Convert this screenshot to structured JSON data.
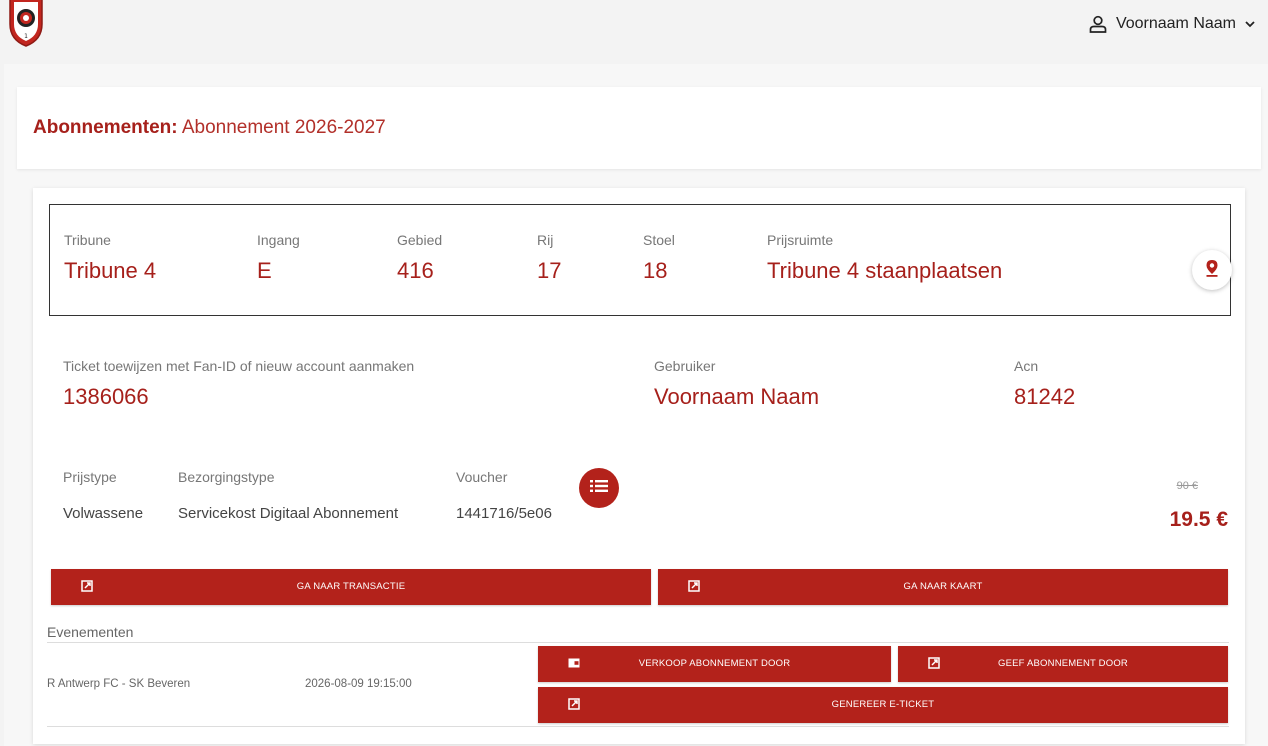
{
  "header": {
    "logo_icon": "club-crest-icon",
    "user_name": "Voornaam Naam",
    "user_icon": "user-icon",
    "chevron_icon": "chevron-down-icon"
  },
  "page": {
    "title_bold": "Abonnementen:",
    "title_rest": "Abonnement 2026-2027"
  },
  "seat": {
    "tribune_label": "Tribune",
    "tribune": "Tribune 4",
    "ingang_label": "Ingang",
    "ingang": "E",
    "gebied_label": "Gebied",
    "gebied": "416",
    "rij_label": "Rij",
    "rij": "17",
    "stoel_label": "Stoel",
    "stoel": "18",
    "prijsruimte_label": "Prijsruimte",
    "prijsruimte": "Tribune 4 staanplaatsen",
    "map_icon": "map-pin-icon"
  },
  "owner": {
    "fanid_label": "Ticket toewijzen met Fan-ID of nieuw account aanmaken",
    "fanid": "1386066",
    "gebruiker_label": "Gebruiker",
    "gebruiker": "Voornaam Naam",
    "acn_label": "Acn",
    "acn": "81242"
  },
  "pricing": {
    "prijstype_label": "Prijstype",
    "prijstype": "Volwassene",
    "bezorgingstype_label": "Bezorgingstype",
    "bezorgingstype": "Servicekost Digitaal Abonnement",
    "voucher_label": "Voucher",
    "voucher": "1441716/5e06",
    "list_icon": "list-icon",
    "old_price": "90 €",
    "new_price": "19.5 €"
  },
  "actions": {
    "transactie": "GA NAAR TRANSACTIE",
    "kaart": "GA NAAR KAART",
    "external_icon": "external-link-icon"
  },
  "events": {
    "title": "Evenementen",
    "rows": [
      {
        "name": "R Antwerp FC - SK Beveren",
        "date": "2026-08-09 19:15:00",
        "verkoop": "VERKOOP ABONNEMENT DOOR",
        "geef": "GEEF ABONNEMENT DOOR",
        "genereer": "GENEREER E-TICKET",
        "wallet_icon": "wallet-icon"
      }
    ]
  },
  "colors": {
    "brand_red": "#b3221b",
    "text_red": "#a6201b"
  }
}
